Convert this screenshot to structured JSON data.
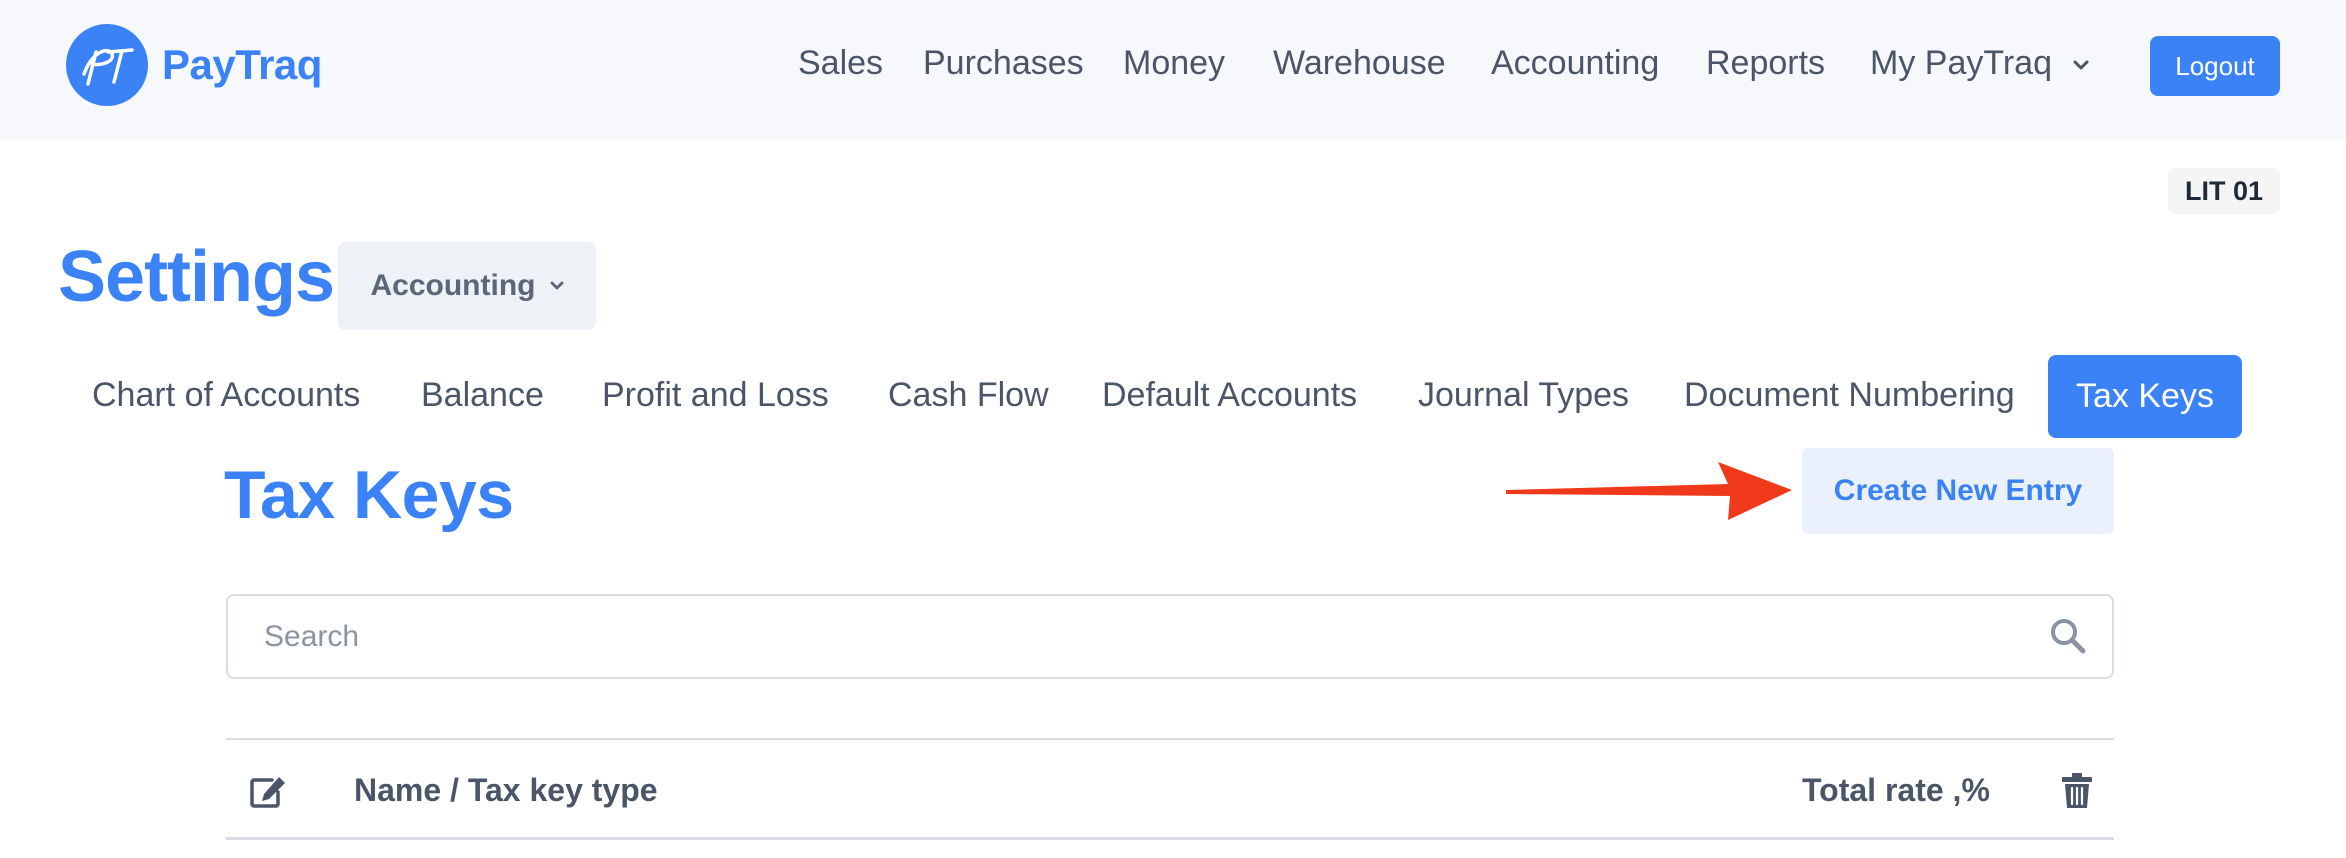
{
  "brand": {
    "name": "PayTraq",
    "monogram": "PT",
    "color": "#3b82f6"
  },
  "nav": {
    "items": [
      "Sales",
      "Purchases",
      "Money",
      "Warehouse",
      "Accounting",
      "Reports"
    ],
    "account_menu": "My PayTraq",
    "logout": "Logout"
  },
  "company_badge": "LIT 01",
  "settings": {
    "title": "Settings",
    "section": "Accounting"
  },
  "tabs": [
    {
      "label": "Chart of Accounts",
      "active": false
    },
    {
      "label": "Balance",
      "active": false
    },
    {
      "label": "Profit and Loss",
      "active": false
    },
    {
      "label": "Cash Flow",
      "active": false
    },
    {
      "label": "Default Accounts",
      "active": false
    },
    {
      "label": "Journal Types",
      "active": false
    },
    {
      "label": "Document Numbering",
      "active": false
    },
    {
      "label": "Tax Keys",
      "active": true
    }
  ],
  "page": {
    "title": "Tax Keys",
    "create_button": "Create New Entry"
  },
  "search": {
    "placeholder": "Search",
    "value": ""
  },
  "table": {
    "columns": {
      "edit_icon": "edit-icon",
      "name": "Name / Tax key type",
      "rate": "Total rate ,%",
      "delete_icon": "trash-icon"
    }
  },
  "annotation": {
    "arrow_color": "#f0381a"
  }
}
